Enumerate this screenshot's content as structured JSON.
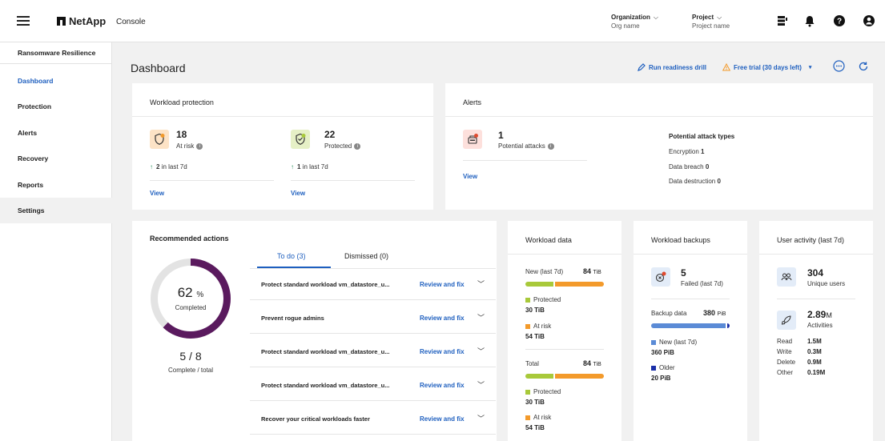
{
  "topbar": {
    "brand": "NetApp",
    "console": "Console",
    "org_label": "Organization",
    "org_value": "Org name",
    "project_label": "Project",
    "project_value": "Project name"
  },
  "sidebar": {
    "title": "Ransomware Resilience",
    "items": [
      {
        "label": "Dashboard"
      },
      {
        "label": "Protection"
      },
      {
        "label": "Alerts"
      },
      {
        "label": "Recovery"
      },
      {
        "label": "Reports"
      },
      {
        "label": "Settings"
      }
    ]
  },
  "header": {
    "title": "Dashboard",
    "drill": "Run readiness drill",
    "trial": "Free trial (30 days left)"
  },
  "workload_protection": {
    "title": "Workload protection",
    "at_risk_num": "18",
    "at_risk_label": "At risk",
    "at_risk_delta": "2",
    "at_risk_delta_label": "in last 7d",
    "protected_num": "22",
    "protected_label": "Protected",
    "protected_delta": "1",
    "protected_delta_label": "in last 7d",
    "view": "View"
  },
  "alerts": {
    "title": "Alerts",
    "num": "1",
    "label": "Potential attacks",
    "view": "View",
    "types_title": "Potential attack types",
    "types": [
      {
        "name": "Encryption",
        "value": "1"
      },
      {
        "name": "Data breach",
        "value": "0"
      },
      {
        "name": "Data destruction",
        "value": "0"
      }
    ]
  },
  "recommended": {
    "title": "Recommended actions",
    "percent": "62",
    "percent_unit": "%",
    "completed": "Completed",
    "fraction": "5 / 8",
    "fraction_label": "Complete / total",
    "progress": 0.62,
    "tab_todo": "To do (3)",
    "tab_dismissed": "Dismissed (0)",
    "review": "Review and fix",
    "rows": [
      {
        "text": "Protect standard workload vm_datastore_u..."
      },
      {
        "text": "Prevent rogue admins"
      },
      {
        "text": "Protect standard workload vm_datastore_u..."
      },
      {
        "text": "Protect standard workload vm_datastore_u..."
      },
      {
        "text": "Recover your critical workloads faster"
      }
    ]
  },
  "workload_data": {
    "title": "Workload data",
    "new_label": "New (last 7d)",
    "new_value": "84",
    "new_unit": "TiB",
    "new_protected_share": 0.36,
    "protected_label": "Protected",
    "protected_value": "30 TiB",
    "atrisk_label": "At risk",
    "atrisk_value": "54 TiB",
    "total_label": "Total",
    "total_value": "84",
    "total_unit": "TiB",
    "total_protected_share": 0.36,
    "protected2_label": "Protected",
    "protected2_value": "30 TiB",
    "atrisk2_label": "At risk",
    "atrisk2_value": "54 TiB"
  },
  "workload_backups": {
    "title": "Workload backups",
    "failed_num": "5",
    "failed_label": "Failed (last 7d)",
    "backup_label": "Backup data",
    "backup_value": "380",
    "backup_unit": "PiB",
    "new_share": 0.95,
    "new_label": "New (last 7d)",
    "new_value": "360 PiB",
    "older_label": "Older",
    "older_value": "20 PiB"
  },
  "user_activity": {
    "title": "User activity (last 7d)",
    "users_num": "304",
    "users_label": "Unique users",
    "activities_num": "2.89",
    "activities_unit": "M",
    "activities_label": "Activities",
    "rows": [
      {
        "name": "Read",
        "value": "1.5M"
      },
      {
        "name": "Write",
        "value": "0.3M"
      },
      {
        "name": "Delete",
        "value": "0.9M"
      },
      {
        "name": "Other",
        "value": "0.19M"
      }
    ]
  },
  "colors": {
    "accent": "#1e5fbf",
    "protected": "#a8c93a",
    "at_risk": "#f39a2b",
    "backup_new": "#5b8bd6",
    "backup_older": "#1a2fa8",
    "donut": "#5a1a5e"
  }
}
